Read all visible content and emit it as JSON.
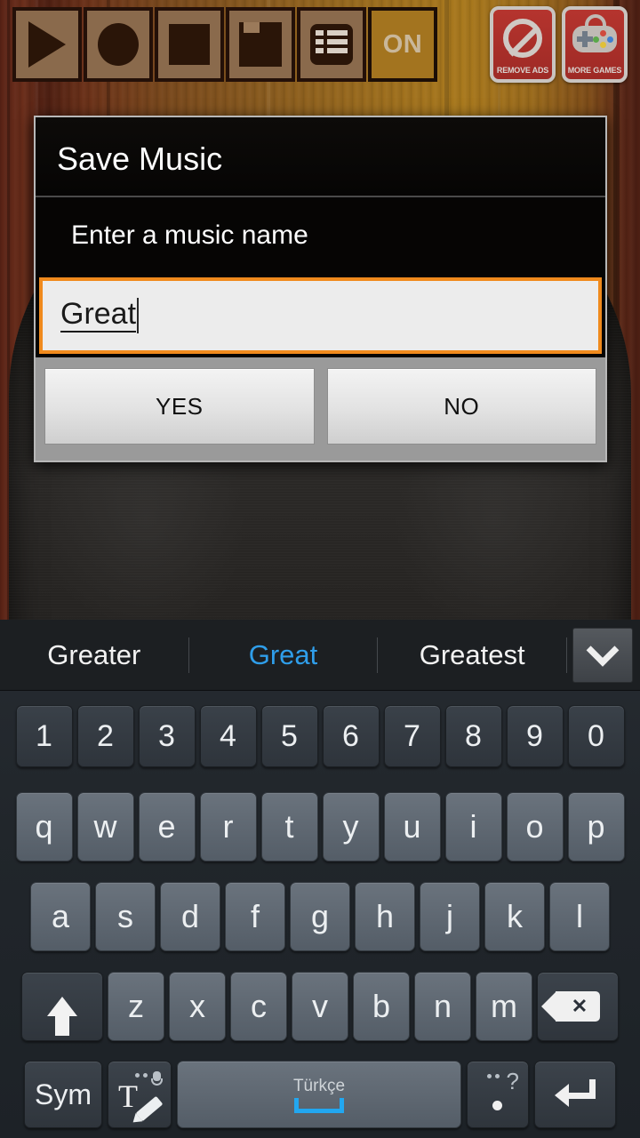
{
  "toolbar": {
    "buttons": [
      {
        "name": "play",
        "icon": "play-icon",
        "label": ""
      },
      {
        "name": "record",
        "icon": "record-icon",
        "label": ""
      },
      {
        "name": "stop",
        "icon": "stop-icon",
        "label": ""
      },
      {
        "name": "save",
        "icon": "save-floppy-icon",
        "label": ""
      },
      {
        "name": "list",
        "icon": "list-icon",
        "label": ""
      },
      {
        "name": "metronome-toggle",
        "icon": "on-toggle",
        "label": "ON"
      }
    ],
    "on_label": "ON",
    "promo": [
      {
        "name": "remove-ads",
        "label": "REMOVE ADS",
        "icon": "no-ads-icon"
      },
      {
        "name": "more-games",
        "label": "MORE GAMES",
        "icon": "gamepad-icon"
      }
    ],
    "promo_bg_color": "#a8322c"
  },
  "dialog": {
    "title": "Save Music",
    "message": "Enter a music name",
    "input": {
      "value": "Great",
      "placeholder": "",
      "border_color": "#f08a1d"
    },
    "buttons": {
      "yes": "YES",
      "no": "NO"
    }
  },
  "keyboard": {
    "suggestions": [
      {
        "text": "Greater",
        "active": false
      },
      {
        "text": "Great",
        "active": true
      },
      {
        "text": "Greatest",
        "active": false
      }
    ],
    "active_suggestion_color": "#2f9eea",
    "expand_icon": "chevron-down-icon",
    "rows": {
      "numbers": [
        "1",
        "2",
        "3",
        "4",
        "5",
        "6",
        "7",
        "8",
        "9",
        "0"
      ],
      "row1": [
        "q",
        "w",
        "e",
        "r",
        "t",
        "y",
        "u",
        "i",
        "o",
        "p"
      ],
      "row2": [
        "a",
        "s",
        "d",
        "f",
        "g",
        "h",
        "j",
        "k",
        "l"
      ],
      "row3": [
        "z",
        "x",
        "c",
        "v",
        "b",
        "n",
        "m"
      ]
    },
    "function_keys": {
      "shift": "shift-icon",
      "backspace": "backspace-icon",
      "sym": "Sym",
      "handwriting": "handwriting-mic-icon",
      "space_label": "Türkçe",
      "period": ".",
      "period_alt": "?",
      "enter": "enter-icon"
    },
    "space_icon_color": "#22a7f0"
  }
}
